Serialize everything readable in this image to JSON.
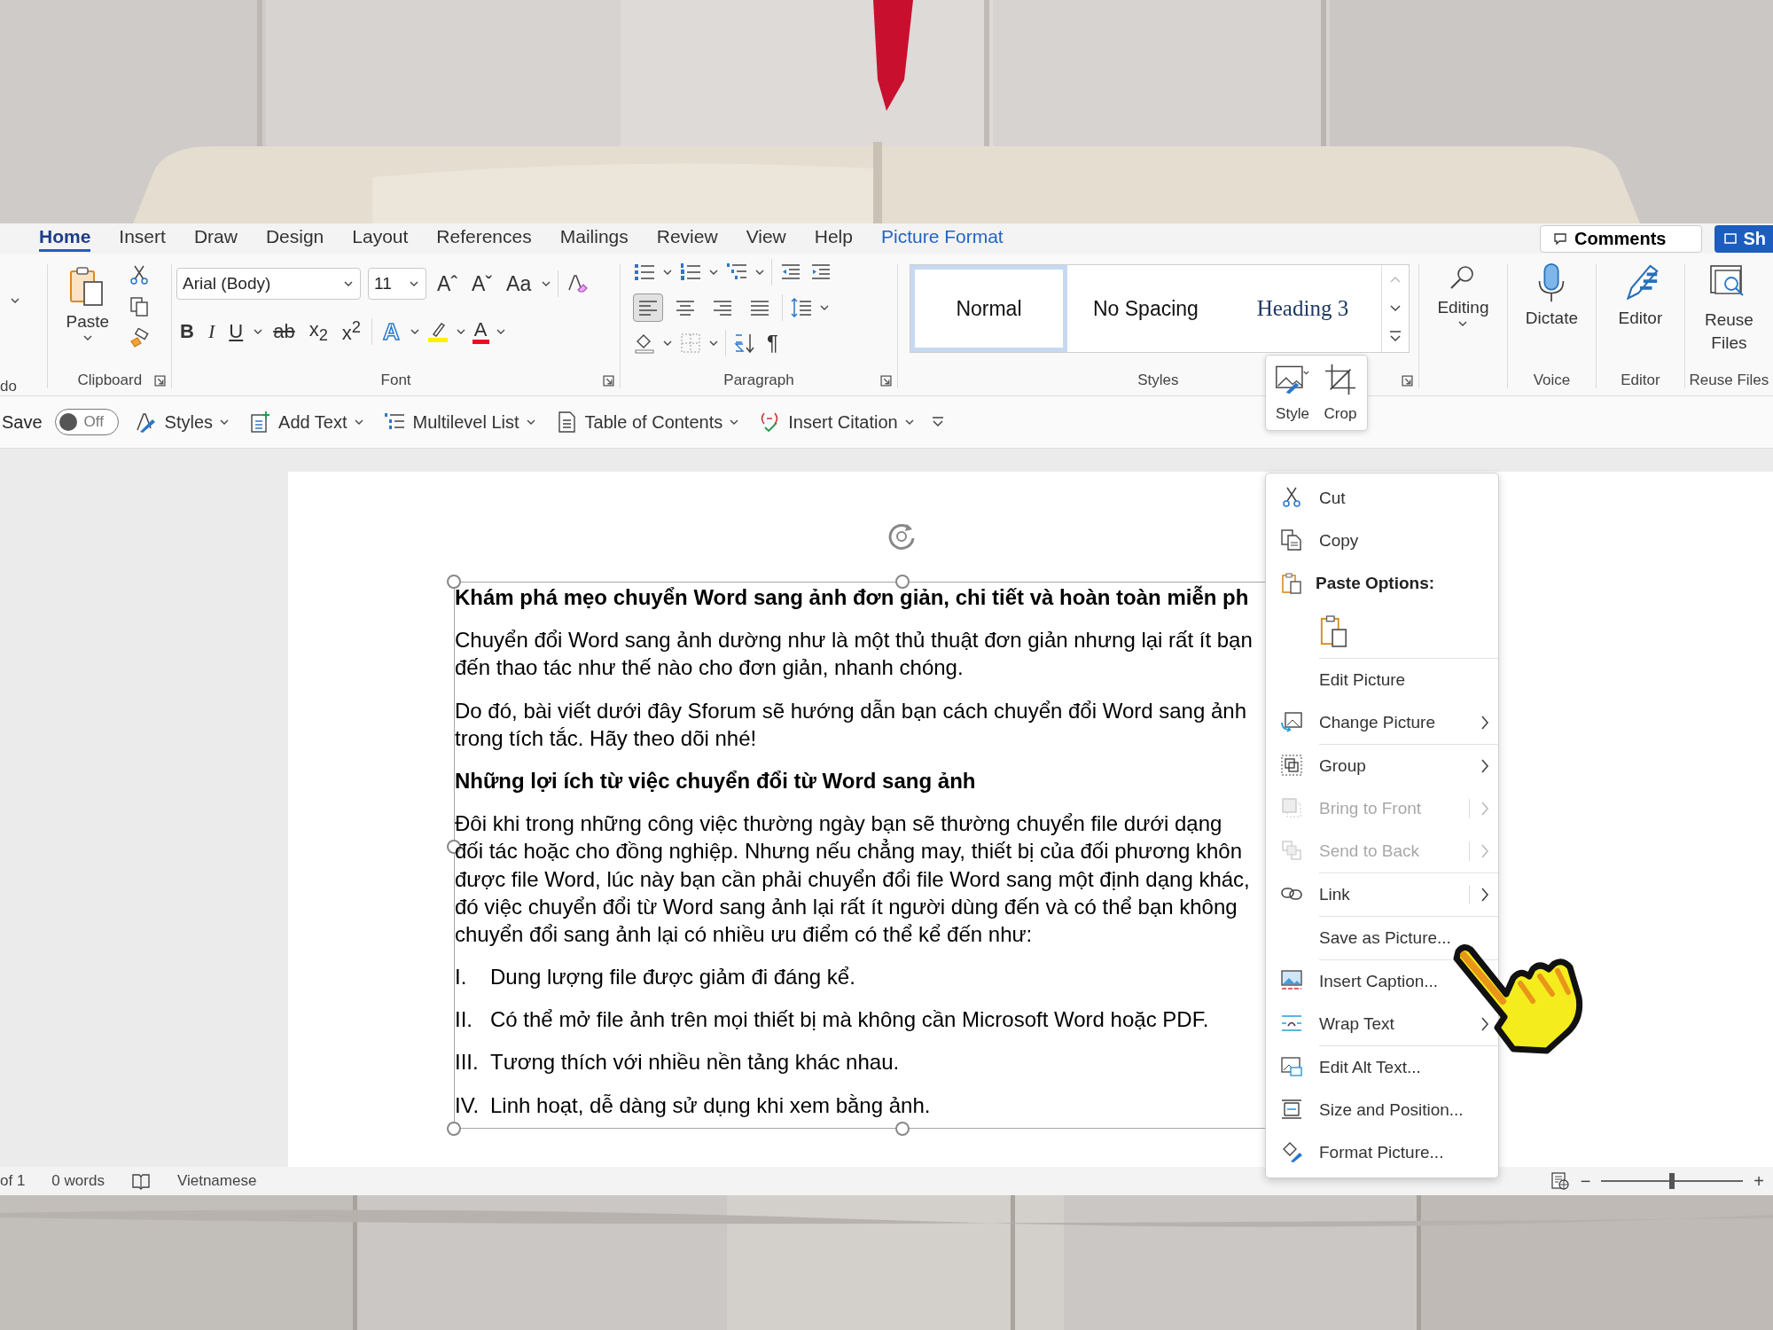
{
  "tabs": [
    {
      "label": "Home",
      "selected": true,
      "kind": "normal"
    },
    {
      "label": "Insert",
      "selected": false,
      "kind": "normal"
    },
    {
      "label": "Draw",
      "selected": false,
      "kind": "normal"
    },
    {
      "label": "Design",
      "selected": false,
      "kind": "normal"
    },
    {
      "label": "Layout",
      "selected": false,
      "kind": "normal"
    },
    {
      "label": "References",
      "selected": false,
      "kind": "normal"
    },
    {
      "label": "Mailings",
      "selected": false,
      "kind": "normal"
    },
    {
      "label": "Review",
      "selected": false,
      "kind": "normal"
    },
    {
      "label": "View",
      "selected": false,
      "kind": "normal"
    },
    {
      "label": "Help",
      "selected": false,
      "kind": "normal"
    },
    {
      "label": "Picture Format",
      "selected": false,
      "kind": "contextual"
    }
  ],
  "comments_button": "Comments",
  "share_button": "Sh",
  "ribbon": {
    "undo_label": "do",
    "clipboard": {
      "paste": "Paste",
      "label": "Clipboard"
    },
    "font": {
      "family": "Arial (Body)",
      "size": "11",
      "grow": "Aˆ",
      "shrink": "Aˇ",
      "case": "Aa",
      "bold": "B",
      "italic": "I",
      "underline": "U",
      "strike": "ab",
      "subscript": "x$_{2}$",
      "superscript": "x$^{2}$",
      "effects": "A",
      "font_color_button": "A",
      "label": "Font"
    },
    "paragraph": {
      "alignment": [
        {
          "kind": "left",
          "selected": true
        },
        {
          "kind": "center",
          "selected": false
        },
        {
          "kind": "right",
          "selected": false
        },
        {
          "kind": "justify",
          "selected": false
        }
      ],
      "pilcrow": "¶",
      "label": "Paragraph"
    },
    "styles": {
      "items": [
        {
          "label": "Normal",
          "selected": true,
          "kind": "normal"
        },
        {
          "label": "No Spacing",
          "selected": false,
          "kind": "normal"
        },
        {
          "label": "Heading 3",
          "selected": false,
          "kind": "heading"
        }
      ],
      "label": "Styles"
    },
    "editing": "Editing",
    "dictate": "Dictate",
    "voice_label": "Voice",
    "editor": "Editor",
    "editor_label": "Editor",
    "reuse": "Reuse Files",
    "reuse_label": "Reuse Files"
  },
  "quick": {
    "autosave": {
      "label": "Save",
      "state": "Off",
      "on": false
    },
    "styles": "Styles",
    "add_text": "Add Text",
    "multilevel": "Multilevel List",
    "toc": "Table of Contents",
    "citation": "Insert Citation"
  },
  "mini_toolbar": [
    {
      "label": "Style",
      "kind": "style"
    },
    {
      "label": "Crop",
      "kind": "crop"
    }
  ],
  "document": {
    "blocks": [
      {
        "kind": "heading",
        "lines": [
          "Khám phá mẹo chuyển Word sang ảnh đơn giản, chi tiết và hoàn toàn miễn ph"
        ]
      },
      {
        "kind": "paragraph",
        "lines": [
          "Chuyển đổi Word sang ảnh dường như là một thủ thuật đơn giản nhưng lại rất ít bạn",
          "đến thao tác như thế nào cho đơn giản, nhanh chóng."
        ]
      },
      {
        "kind": "paragraph",
        "lines": [
          "Do đó, bài viết dưới đây Sforum sẽ hướng dẫn bạn cách chuyển đổi Word sang ảnh",
          "trong tích tắc. Hãy theo dõi nhé!"
        ]
      },
      {
        "kind": "heading",
        "lines": [
          "Những lợi ích từ việc chuyển đổi từ Word sang ảnh"
        ]
      },
      {
        "kind": "paragraph",
        "lines": [
          "Đôi khi trong những công việc thường ngày bạn sẽ thường chuyển file dưới dạng",
          "đối tác hoặc cho đồng nghiệp. Nhưng nếu chẳng may, thiết bị của đối phương khôn",
          "được file Word, lúc này bạn cần phải chuyển đổi file Word sang một định dạng khác,",
          "đó việc chuyển đổi từ Word sang ảnh lại rất ít người dùng đến và có thể bạn không",
          "chuyển đổi sang ảnh lại có nhiều ưu điểm có thể kể đến như:"
        ]
      },
      {
        "kind": "list_item",
        "number": "I.",
        "text": "Dung lượng file được giảm đi đáng kể."
      },
      {
        "kind": "list_item",
        "number": "II.",
        "text": "Có thể mở file ảnh trên mọi thiết bị mà không cần Microsoft Word hoặc PDF."
      },
      {
        "kind": "list_item",
        "number": "III.",
        "text": "Tương thích với nhiều nền tảng khác nhau."
      },
      {
        "kind": "list_item",
        "number": "IV.",
        "text": "Linh hoạt, dễ dàng sử dụng khi xem bằng ảnh."
      }
    ]
  },
  "context_menu": [
    [
      {
        "label": "Cut",
        "kind": "cut",
        "submenu": false,
        "disabled": false
      },
      {
        "label": "Copy",
        "kind": "copy",
        "submenu": false,
        "disabled": false
      },
      {
        "label": "Paste Options:",
        "kind": "header",
        "submenu": false,
        "disabled": false
      },
      {
        "kind": "paste_row",
        "submenu": false,
        "disabled": false
      }
    ],
    [
      {
        "label": "Edit Picture",
        "kind": "plain",
        "submenu": false,
        "disabled": false
      },
      {
        "label": "Change Picture",
        "kind": "change",
        "submenu": true,
        "disabled": false
      }
    ],
    [
      {
        "label": "Group",
        "kind": "group",
        "submenu": true,
        "disabled": false
      },
      {
        "label": "Bring to Front",
        "kind": "front",
        "submenu": true,
        "disabled": true
      },
      {
        "label": "Send to Back",
        "kind": "back",
        "submenu": true,
        "disabled": true
      }
    ],
    [
      {
        "label": "Link",
        "kind": "link",
        "submenu": true,
        "disabled": false
      }
    ],
    [
      {
        "label": "Save as Picture...",
        "kind": "plain",
        "submenu": false,
        "disabled": false
      }
    ],
    [
      {
        "label": "Insert Caption...",
        "kind": "caption",
        "submenu": false,
        "disabled": false
      },
      {
        "label": "Wrap Text",
        "kind": "wrap",
        "submenu": true,
        "disabled": false
      }
    ],
    [
      {
        "label": "Edit Alt Text...",
        "kind": "alt",
        "submenu": false,
        "disabled": false
      },
      {
        "label": "Size and Position...",
        "kind": "size",
        "submenu": false,
        "disabled": false
      },
      {
        "label": "Format Picture...",
        "kind": "format",
        "submenu": false,
        "disabled": false
      }
    ]
  ],
  "status_bar": {
    "page": "of 1",
    "words": "0 words",
    "language": "Vietnamese",
    "zoom": {
      "minus": "−",
      "plus": "+",
      "level": 0.5
    }
  }
}
